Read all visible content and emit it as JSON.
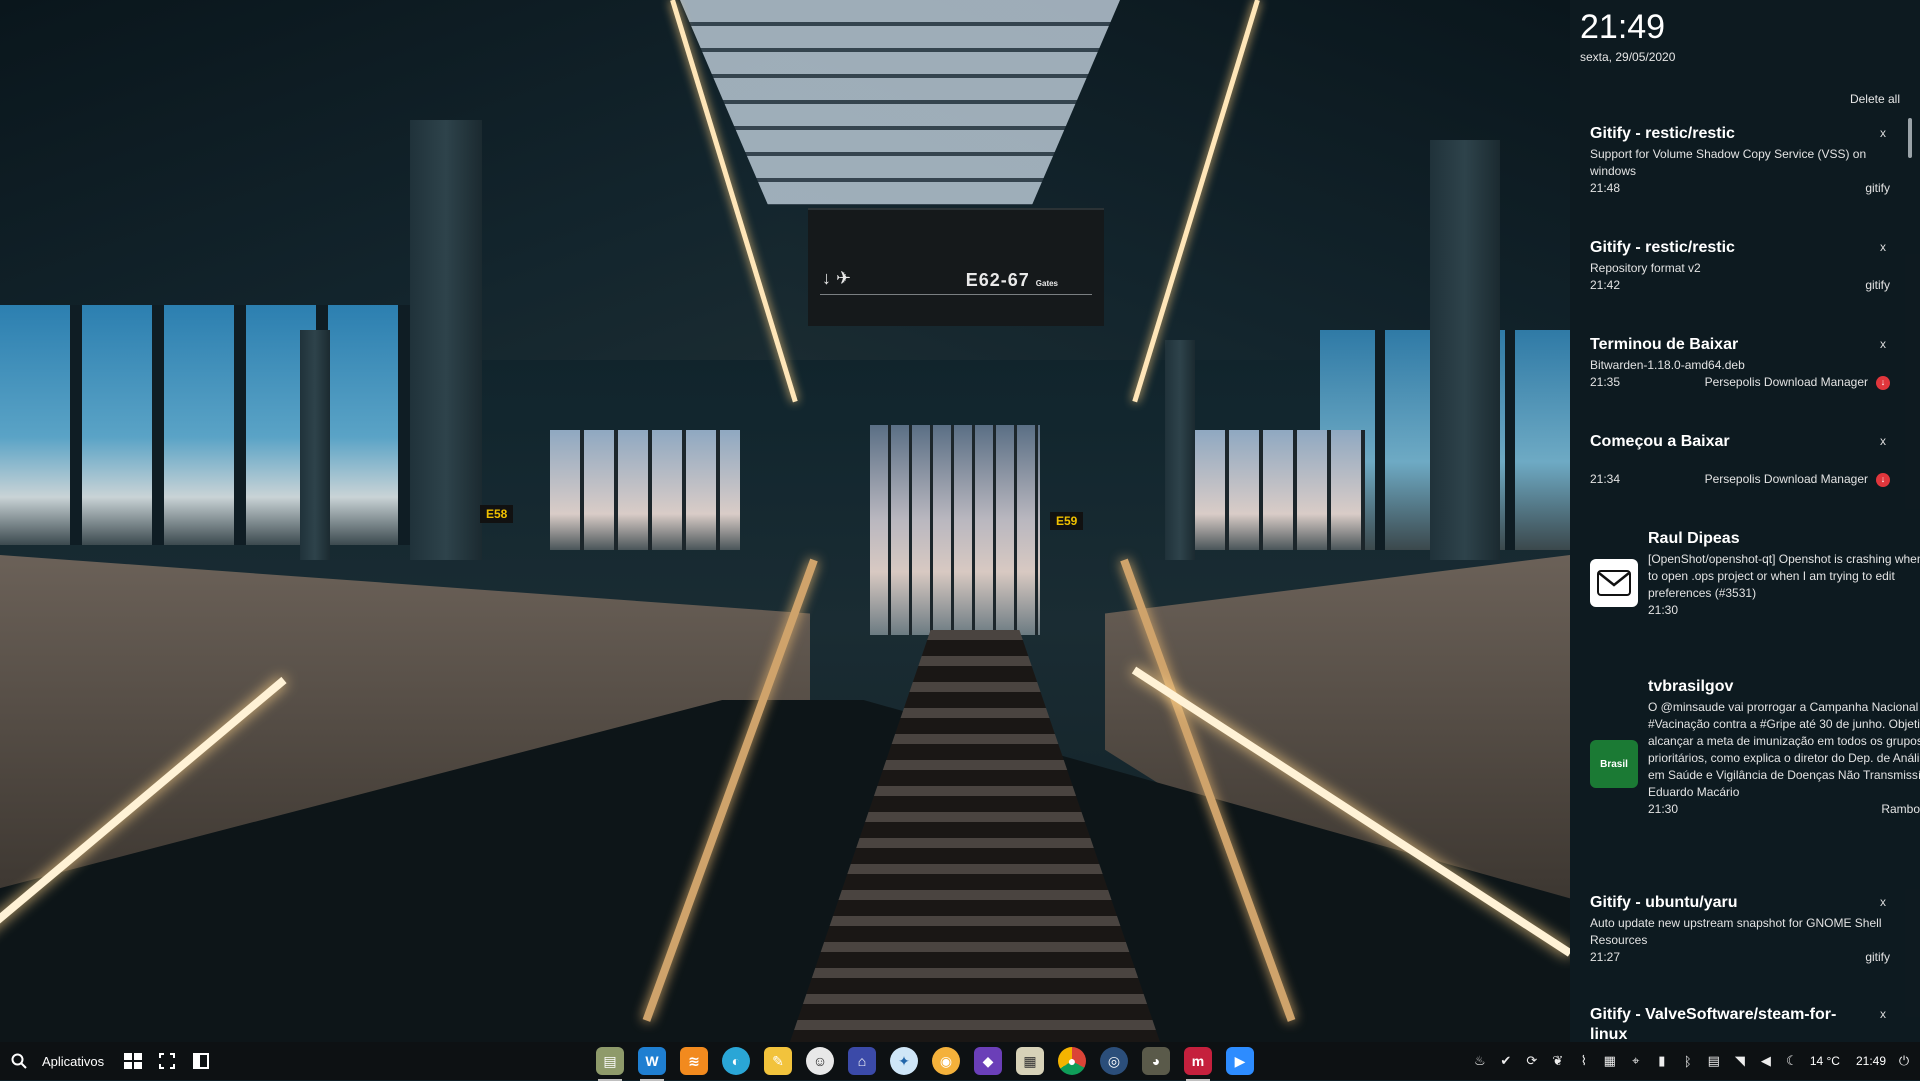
{
  "panel": {
    "clock": "21:49",
    "date": "sexta, 29/05/2020",
    "delete_all": "Delete all",
    "close_glyph": "x",
    "notifications": [
      {
        "title": "Gitify - restic/restic",
        "body": "Support for Volume Shadow Copy Service (VSS) on windows",
        "time": "21:48",
        "app": "gitify"
      },
      {
        "title": "Gitify - restic/restic",
        "body": "Repository format v2",
        "time": "21:42",
        "app": "gitify"
      },
      {
        "title": "Terminou de Baixar",
        "body": "Bitwarden-1.18.0-amd64.deb",
        "time": "21:35",
        "app": "Persepolis Download Manager"
      },
      {
        "title": "Começou a Baixar",
        "body": "",
        "time": "21:34",
        "app": "Persepolis Download Manager"
      },
      {
        "title": "Raul Dipeas",
        "body": "[OpenShot/openshot-qt] Openshot is crashing when I try to open .ops project or when I am trying to edit preferences (#3531)",
        "time": "21:30",
        "app": ""
      },
      {
        "title": "tvbrasilgov",
        "body": "O @minsaude vai prorrogar a Campanha Nacional de #Vacinação contra a #Gripe até 30 de junho. Objetivo é alcançar a meta de imunização em todos os grupos prioritários, como explica o diretor do Dep. de Análise em Saúde e Vigilância de Doenças Não Transmissíveis, Eduardo Macário",
        "time": "21:30",
        "app": "Rambox",
        "icon_text": "Brasil"
      },
      {
        "title": "Gitify - ubuntu/yaru",
        "body": "Auto update new upstream snapshot for GNOME Shell Resources",
        "time": "21:27",
        "app": "gitify"
      },
      {
        "title": "Gitify - ValveSoftware/steam-for-linux",
        "body": "",
        "time": "",
        "app": ""
      }
    ]
  },
  "wallpaper": {
    "gate_sign": "E62-67",
    "gate_sign_sub": "Gates",
    "sign_e58": "E58",
    "sign_e59": "E59"
  },
  "taskbar": {
    "apps_label": "Aplicativos",
    "weather": "14 °C",
    "time": "21:49",
    "dock_icons": [
      "file-manager-icon",
      "writer-icon",
      "rss-reader-icon",
      "browser-icon",
      "notes-icon",
      "mascot-icon",
      "vpn-icon",
      "safari-like-icon",
      "photos-icon",
      "kdenlive-icon",
      "archive-icon",
      "chrome-icon",
      "network-icon",
      "gimp-icon",
      "mendeley-icon",
      "zoom-icon"
    ]
  },
  "colors": {
    "panel_bg": "#0e1a20",
    "taskbar_bg": "#0d1113",
    "persepolis_badge": "#e0363c",
    "rambox_badge": "#2f8fd8",
    "gate_sign_bg": "#15191b"
  }
}
